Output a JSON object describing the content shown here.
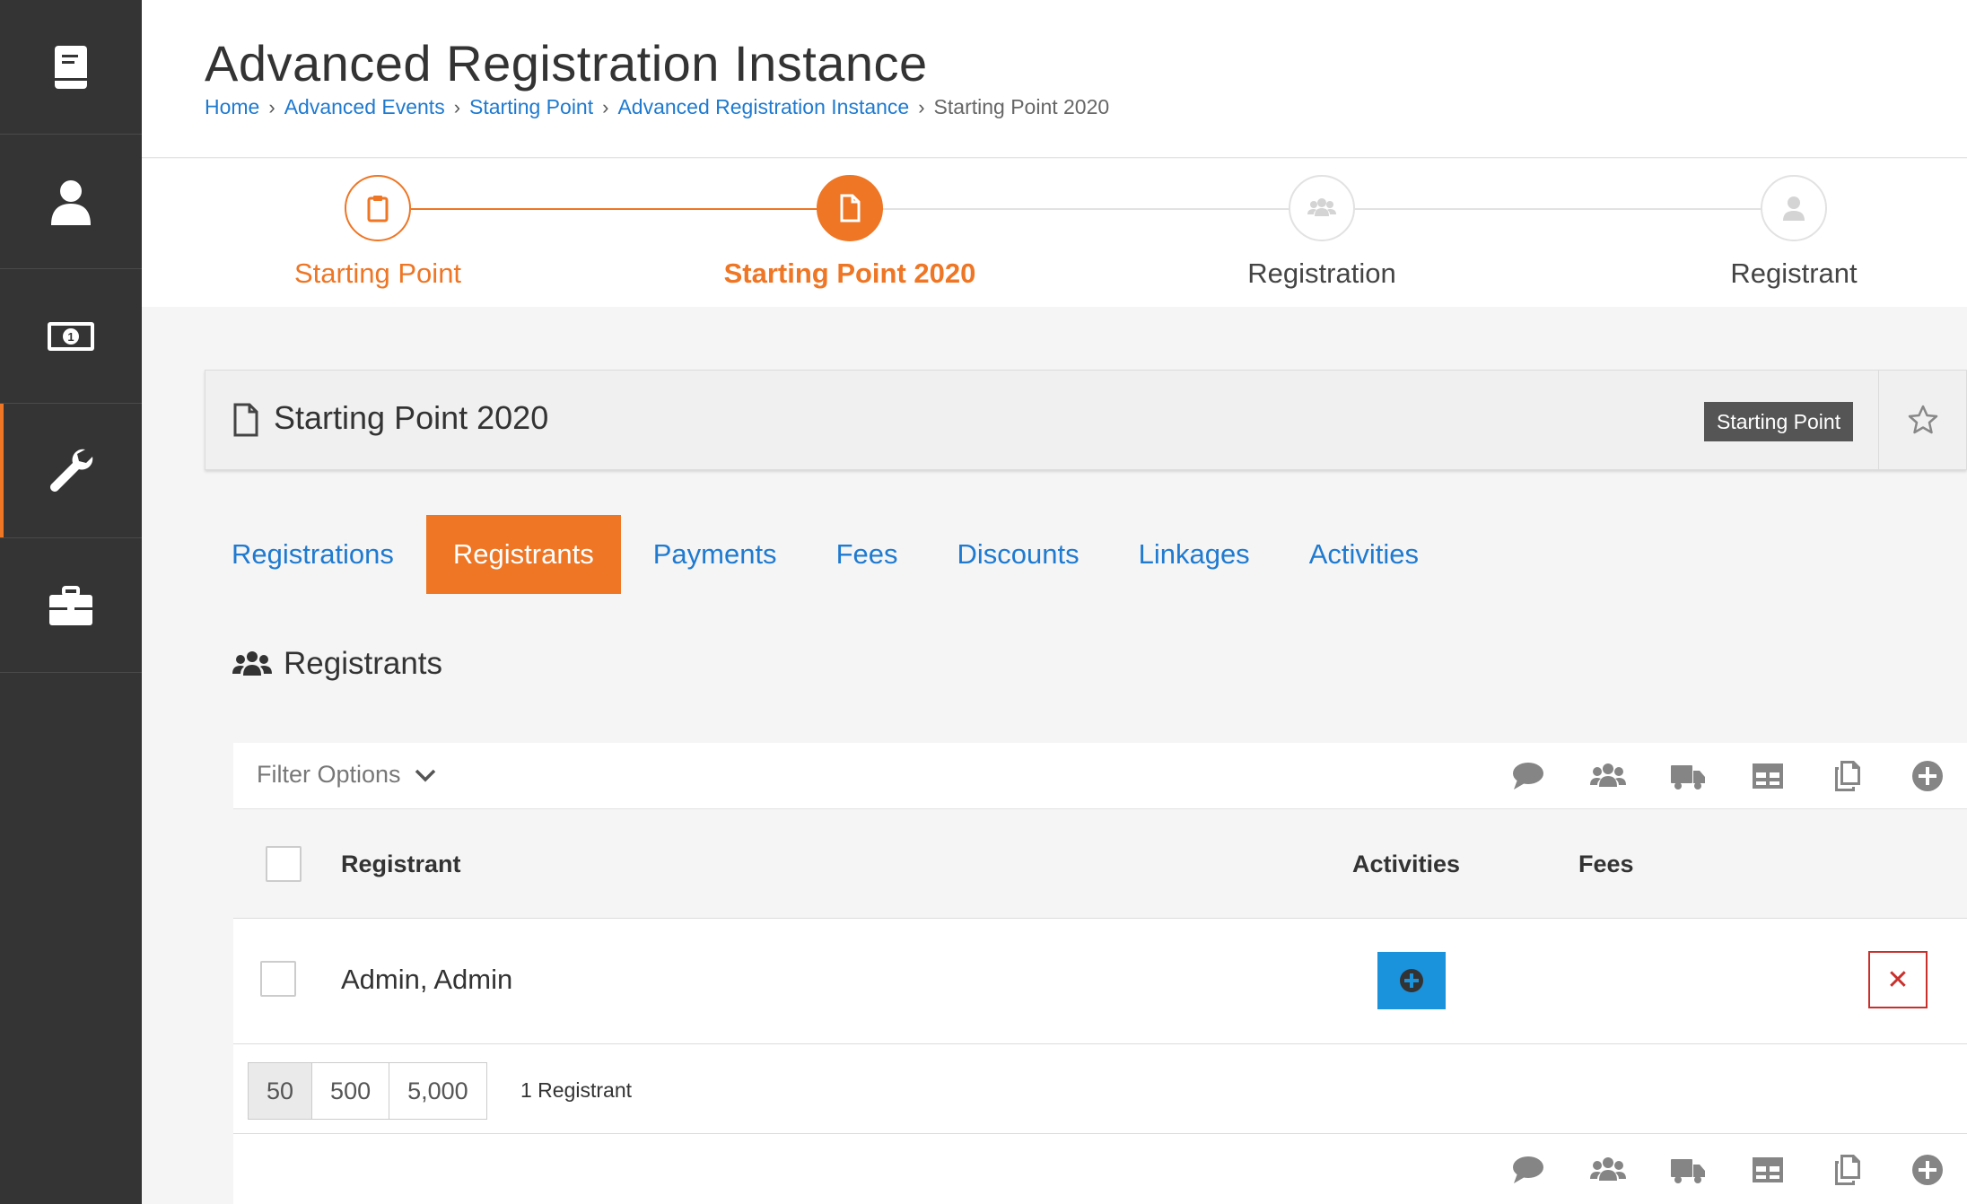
{
  "header": {
    "title": "Advanced Registration Instance",
    "breadcrumb": [
      "Home",
      "Advanced Events",
      "Starting Point",
      "Advanced Registration Instance",
      "Starting Point 2020"
    ]
  },
  "steps": [
    {
      "label": "Starting Point",
      "state": "done",
      "icon": "clipboard-icon"
    },
    {
      "label": "Starting Point 2020",
      "state": "current",
      "icon": "file-icon"
    },
    {
      "label": "Registration",
      "state": "pending",
      "icon": "users-icon"
    },
    {
      "label": "Registrant",
      "state": "pending",
      "icon": "user-icon"
    }
  ],
  "panel": {
    "title": "Starting Point 2020",
    "tag": "Starting Point"
  },
  "tabs": [
    "Registrations",
    "Registrants",
    "Payments",
    "Fees",
    "Discounts",
    "Linkages",
    "Activities"
  ],
  "active_tab": "Registrants",
  "section": {
    "title": "Registrants"
  },
  "grid": {
    "filter_label": "Filter Options",
    "columns": {
      "registrant": "Registrant",
      "activities": "Activities",
      "fees": "Fees"
    },
    "rows": [
      {
        "name": "Admin, Admin"
      }
    ],
    "page_sizes": [
      "50",
      "500",
      "5,000"
    ],
    "count_text": "1 Registrant"
  },
  "colors": {
    "accent": "#ee7625",
    "link": "#1f7ad0",
    "sidebar": "#343434",
    "primary_button": "#1b92dc",
    "danger": "#c9302c"
  }
}
